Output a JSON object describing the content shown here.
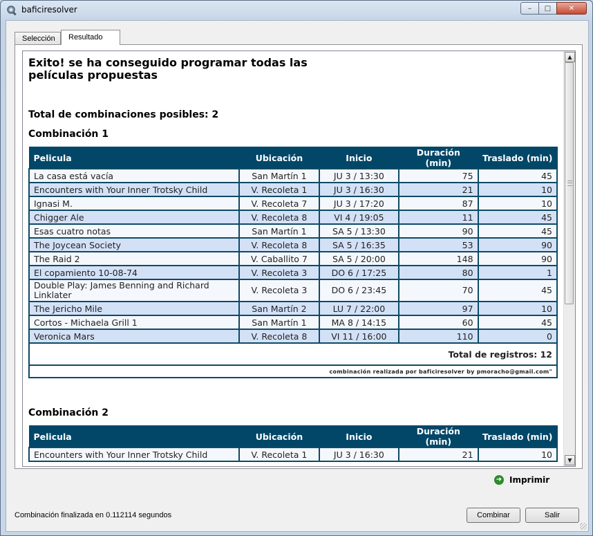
{
  "window": {
    "title": "baficiresolver",
    "min_glyph": "–",
    "max_glyph": "□",
    "close_glyph": "✕"
  },
  "tabs": [
    {
      "label": "Selección"
    },
    {
      "label": "Resultado"
    }
  ],
  "result": {
    "headline": "Exito! se ha conseguido programar todas las películas propuestas",
    "total_combinations": "Total de combinaciones posibles: 2",
    "columns": [
      "Pelicula",
      "Ubicación",
      "Inicio",
      "Duración (min)",
      "Traslado (min)"
    ],
    "combinations": [
      {
        "title": "Combinación 1",
        "rows": [
          [
            "La casa está vacía",
            "San Martín 1",
            "JU 3 / 13:30",
            "75",
            "45"
          ],
          [
            "Encounters with Your Inner Trotsky Child",
            "V. Recoleta 1",
            "JU 3 / 16:30",
            "21",
            "10"
          ],
          [
            "Ignasi M.",
            "V. Recoleta 7",
            "JU 3 / 17:20",
            "87",
            "10"
          ],
          [
            "Chigger Ale",
            "V. Recoleta 8",
            "VI 4 / 19:05",
            "11",
            "45"
          ],
          [
            "Esas cuatro notas",
            "San Martín 1",
            "SA 5 / 13:30",
            "90",
            "45"
          ],
          [
            "The Joycean Society",
            "V. Recoleta 8",
            "SA 5 / 16:35",
            "53",
            "90"
          ],
          [
            "The Raid 2",
            "V. Caballito 7",
            "SA 5 / 20:00",
            "148",
            "90"
          ],
          [
            "El copamiento 10-08-74",
            "V. Recoleta 3",
            "DO 6 / 17:25",
            "80",
            "1"
          ],
          [
            "Double Play: James Benning and Richard Linklater",
            "V. Recoleta 3",
            "DO 6 / 23:45",
            "70",
            "45"
          ],
          [
            "The Jericho Mile",
            "San Martín 2",
            "LU 7 / 22:00",
            "97",
            "10"
          ],
          [
            "Cortos - Michaela Grill 1",
            "San Martín 1",
            "MA 8 / 14:15",
            "60",
            "45"
          ],
          [
            "Veronica Mars",
            "V. Recoleta 8",
            "VI 11 / 16:00",
            "110",
            "0"
          ]
        ],
        "total": "Total de registros: 12",
        "footer": "combinación realizada por baficiresolver by pmoracho@gmail.com\""
      },
      {
        "title": "Combinación 2",
        "rows": [
          [
            "Encounters with Your Inner Trotsky Child",
            "V. Recoleta 1",
            "JU 3 / 16:30",
            "21",
            "10"
          ]
        ]
      }
    ]
  },
  "scroll": {
    "up_glyph": "▲",
    "down_glyph": "▼"
  },
  "actions": {
    "print_label": "Imprimir",
    "print_glyph": "➜",
    "combinar_label": "Combinar",
    "salir_label": "Salir"
  },
  "status": "Combinación finalizada en 0.112114 segundos"
}
